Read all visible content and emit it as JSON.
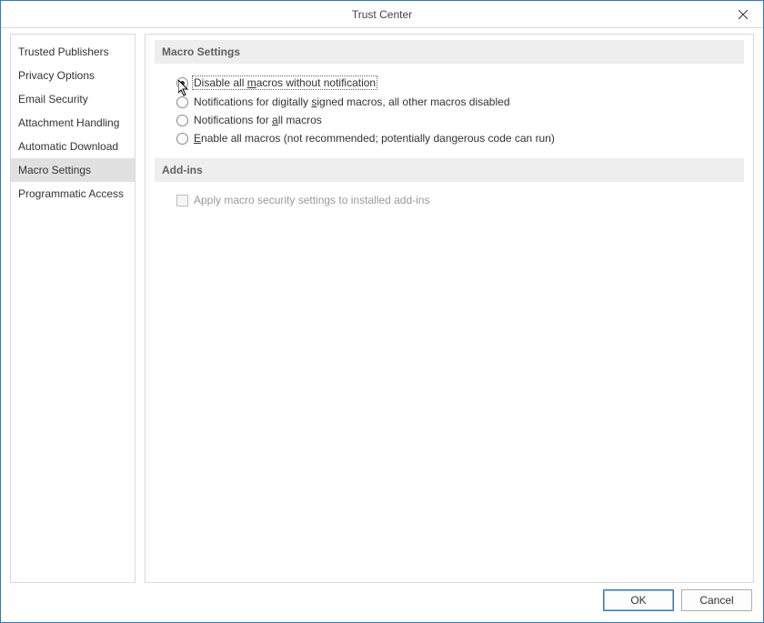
{
  "window": {
    "title": "Trust Center"
  },
  "sidebar": {
    "items": [
      {
        "label": "Trusted Publishers"
      },
      {
        "label": "Privacy Options"
      },
      {
        "label": "Email Security"
      },
      {
        "label": "Attachment Handling"
      },
      {
        "label": "Automatic Download"
      },
      {
        "label": "Macro Settings"
      },
      {
        "label": "Programmatic Access"
      }
    ],
    "selected_index": 5
  },
  "sections": {
    "macro_settings": {
      "title": "Macro Settings",
      "options": [
        {
          "prefix": "Disable all ",
          "mn": "m",
          "suffix": "acros without notification",
          "selected": true,
          "focused": true
        },
        {
          "prefix": "Notifications for digitally ",
          "mn": "s",
          "suffix": "igned macros, all other macros disabled",
          "selected": false,
          "focused": false
        },
        {
          "prefix": "Notifications for ",
          "mn": "a",
          "suffix": "ll macros",
          "selected": false,
          "focused": false
        },
        {
          "prefix": "",
          "mn": "E",
          "suffix": "nable all macros (not recommended; potentially dangerous code can run)",
          "selected": false,
          "focused": false
        }
      ]
    },
    "addins": {
      "title": "Add-ins",
      "checkbox_label": "Apply macro security settings to installed add-ins",
      "checkbox_enabled": false
    }
  },
  "buttons": {
    "ok": "OK",
    "cancel": "Cancel"
  }
}
